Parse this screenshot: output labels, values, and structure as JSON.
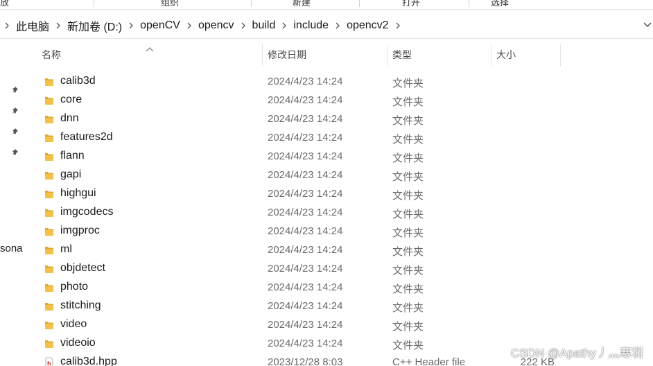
{
  "ribbon": {
    "items": [
      "放",
      "组织",
      "新建",
      "打开",
      "选择"
    ]
  },
  "breadcrumb": {
    "items": [
      "此电脑",
      "新加卷 (D:)",
      "openCV",
      "opencv",
      "build",
      "include",
      "opencv2"
    ]
  },
  "nav": {
    "partial_label": "sona"
  },
  "columns": {
    "name": "名称",
    "date": "修改日期",
    "type": "类型",
    "size": "大小"
  },
  "files": [
    {
      "name": "calib3d",
      "date": "2024/4/23 14:24",
      "type": "文件夹",
      "size": "",
      "kind": "folder"
    },
    {
      "name": "core",
      "date": "2024/4/23 14:24",
      "type": "文件夹",
      "size": "",
      "kind": "folder"
    },
    {
      "name": "dnn",
      "date": "2024/4/23 14:24",
      "type": "文件夹",
      "size": "",
      "kind": "folder"
    },
    {
      "name": "features2d",
      "date": "2024/4/23 14:24",
      "type": "文件夹",
      "size": "",
      "kind": "folder"
    },
    {
      "name": "flann",
      "date": "2024/4/23 14:24",
      "type": "文件夹",
      "size": "",
      "kind": "folder"
    },
    {
      "name": "gapi",
      "date": "2024/4/23 14:24",
      "type": "文件夹",
      "size": "",
      "kind": "folder"
    },
    {
      "name": "highgui",
      "date": "2024/4/23 14:24",
      "type": "文件夹",
      "size": "",
      "kind": "folder"
    },
    {
      "name": "imgcodecs",
      "date": "2024/4/23 14:24",
      "type": "文件夹",
      "size": "",
      "kind": "folder"
    },
    {
      "name": "imgproc",
      "date": "2024/4/23 14:24",
      "type": "文件夹",
      "size": "",
      "kind": "folder"
    },
    {
      "name": "ml",
      "date": "2024/4/23 14:24",
      "type": "文件夹",
      "size": "",
      "kind": "folder"
    },
    {
      "name": "objdetect",
      "date": "2024/4/23 14:24",
      "type": "文件夹",
      "size": "",
      "kind": "folder"
    },
    {
      "name": "photo",
      "date": "2024/4/23 14:24",
      "type": "文件夹",
      "size": "",
      "kind": "folder"
    },
    {
      "name": "stitching",
      "date": "2024/4/23 14:24",
      "type": "文件夹",
      "size": "",
      "kind": "folder"
    },
    {
      "name": "video",
      "date": "2024/4/23 14:24",
      "type": "文件夹",
      "size": "",
      "kind": "folder"
    },
    {
      "name": "videoio",
      "date": "2024/4/23 14:24",
      "type": "文件夹",
      "size": "",
      "kind": "folder"
    },
    {
      "name": "calib3d.hpp",
      "date": "2023/12/28 8:03",
      "type": "C++ Header file",
      "size": "222 KB",
      "kind": "header"
    }
  ],
  "watermark": "CSDN @Apathy丿灬寒羽",
  "colors": {
    "folder": "#f3c04a",
    "folder_dark": "#e0a82e",
    "header_icon": "#c0392b"
  }
}
